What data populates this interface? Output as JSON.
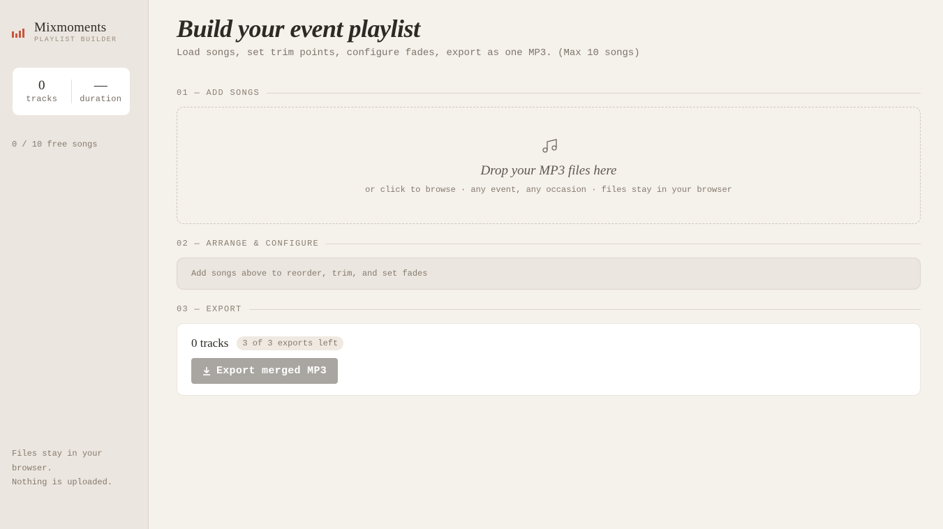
{
  "brand": {
    "name": "Mixmoments",
    "subtitle": "PLAYLIST BUILDER",
    "accent_color": "#c8553d",
    "icon": "bars-icon"
  },
  "stats": {
    "tracks_value": "0",
    "tracks_label": "tracks",
    "duration_value": "—",
    "duration_label": "duration"
  },
  "sidebar": {
    "free_songs": "0 / 10 free songs",
    "files_note_line1": "Files stay in your browser.",
    "files_note_line2": "Nothing is uploaded."
  },
  "header": {
    "title": "Build your event playlist",
    "subtitle": "Load songs, set trim points, configure fades, export as one MP3. (Max 10 songs)"
  },
  "sections": {
    "add": {
      "heading": "01 — ADD SONGS",
      "drop_title": "Drop your MP3 files here",
      "drop_sub": "or click to browse · any event, any occasion · files stay in your browser",
      "icon": "music-note-icon"
    },
    "arrange": {
      "heading": "02 — ARRANGE & CONFIGURE",
      "empty_text": "Add songs above to reorder, trim, and set fades"
    },
    "export": {
      "heading": "03 — EXPORT",
      "tracks_text": "0 tracks",
      "exports_left": "3 of 3 exports left",
      "button_label": "Export merged MP3",
      "button_icon": "download-icon"
    }
  }
}
